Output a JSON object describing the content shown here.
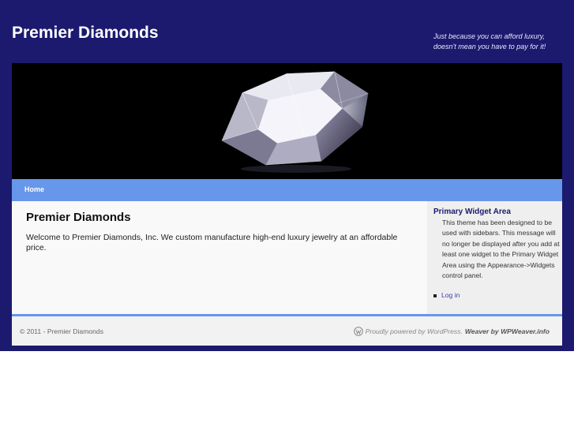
{
  "site": {
    "title": "Premier Diamonds",
    "tagline_line1": "Just because you can afford luxury,",
    "tagline_line2": "doesn't mean you have to pay for it!"
  },
  "nav": {
    "items": [
      {
        "label": "Home"
      }
    ]
  },
  "post": {
    "title": "Premier Diamonds",
    "body": "Welcome to Premier Diamonds, Inc.  We custom manufacture high-end luxury jewelry at an affordable price."
  },
  "sidebar": {
    "widget_title": "Primary Widget Area",
    "widget_text": "This theme has been designed to be used with sidebars. This message will no longer be displayed after you add at least one widget to the Primary Widget Area using the Appearance->Widgets control panel.",
    "links": [
      {
        "label": "Log in"
      }
    ]
  },
  "footer": {
    "copyright": "© 2011 - Premier Diamonds",
    "powered_text": "Proudly powered by WordPress.",
    "weaver_text": "Weaver by WPWeaver.info"
  },
  "colors": {
    "background": "#1c1a6e",
    "nav": "#6797ea",
    "header": "#000000"
  },
  "icons": {
    "header_image": "diamond-image",
    "footer_icon": "wordpress-icon"
  }
}
